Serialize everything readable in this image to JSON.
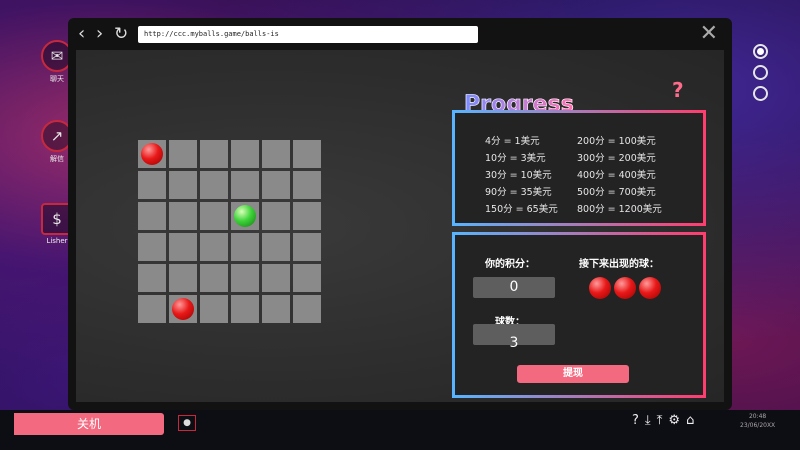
{
  "desktop": {
    "icons": [
      {
        "glyph": "✉",
        "label": "聊天",
        "name": "chat-icon"
      },
      {
        "glyph": "↗",
        "label": "解信",
        "name": "chart-icon"
      },
      {
        "glyph": "$",
        "label": "Lisher",
        "name": "coin-icon"
      }
    ],
    "radio_count": 3
  },
  "browser": {
    "url": "http://ccc.myballs.game/balls-is",
    "back_glyph": "‹",
    "forward_glyph": "›",
    "reload_glyph": "↻",
    "close_glyph": "✕"
  },
  "game": {
    "grid_size": 6,
    "balls": [
      {
        "row": 0,
        "col": 0,
        "color": "red"
      },
      {
        "row": 2,
        "col": 3,
        "color": "green"
      },
      {
        "row": 5,
        "col": 1,
        "color": "red"
      }
    ]
  },
  "progress": {
    "title": "Progress",
    "help_glyph": "?",
    "rates": [
      "4分 = 1美元",
      "200分 = 100美元",
      "10分 = 3美元",
      "300分 = 200美元",
      "30分 = 10美元",
      "400分 = 400美元",
      "90分 = 35美元",
      "500分 = 700美元",
      "150分 = 65美元",
      "800分 = 1200美元"
    ]
  },
  "score": {
    "score_label": "你的积分：",
    "score_value": "0",
    "next_label": "接下来出现的球：",
    "next_balls": 3,
    "balls_label": "球数：",
    "balls_value": "3",
    "withdraw_label": "提现"
  },
  "taskbar": {
    "shutdown_label": "关机",
    "tray_icons": [
      {
        "glyph": "?",
        "name": "help-icon"
      },
      {
        "glyph": "⤓",
        "name": "download-icon"
      },
      {
        "glyph": "⤒",
        "name": "upload-icon"
      },
      {
        "glyph": "⚙",
        "name": "gear-icon"
      },
      {
        "glyph": "⌂",
        "name": "home-icon"
      }
    ],
    "clock_time": "20:48",
    "clock_date": "23/06/20XX"
  }
}
